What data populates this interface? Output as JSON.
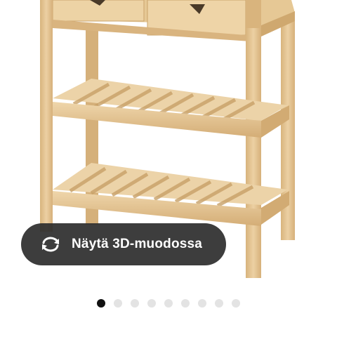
{
  "view_3d_button": {
    "label": "Näytä 3D-muodossa",
    "icon": "rotate-arrows-icon"
  },
  "carousel": {
    "total_slides": 9,
    "active_index": 0
  },
  "colors": {
    "wood": "#e2c28f",
    "wood_shadow": "#c9a46b",
    "button_bg": "#2d2d2d",
    "dot_active": "#111111",
    "dot_inactive": "#e3e3e3"
  }
}
